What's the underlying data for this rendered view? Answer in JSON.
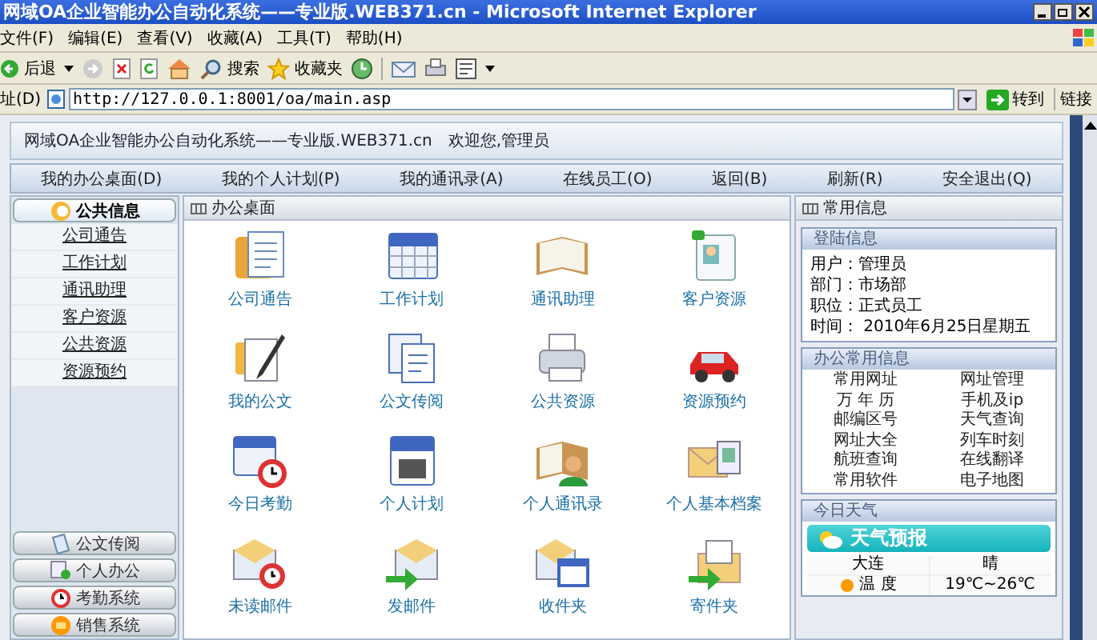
{
  "window": {
    "title": "网域OA企业智能办公自动化系统——专业版.WEB371.cn - Microsoft Internet Explorer"
  },
  "menu_bar": [
    "文件(F)",
    "编辑(E)",
    "查看(V)",
    "收藏(A)",
    "工具(T)",
    "帮助(H)"
  ],
  "toolbar": {
    "back": "后退",
    "search": "搜索",
    "favorites": "收藏夹"
  },
  "address_bar": {
    "label": "址(D)",
    "url": "http://127.0.0.1:8001/oa/main.asp",
    "go": "转到",
    "links": "链接"
  },
  "header": {
    "title": "网域OA企业智能办公自动化系统——专业版.WEB371.cn",
    "welcome": "欢迎您,管理员"
  },
  "nav": [
    "我的办公桌面(D)",
    "我的个人计划(P)",
    "我的通讯录(A)",
    "在线员工(O)",
    "返回(B)",
    "刷新(R)",
    "安全退出(Q)"
  ],
  "sidebar": {
    "groups": [
      {
        "label": "公共信息",
        "expanded": true,
        "items": [
          "公司通告",
          "工作计划",
          "通讯助理",
          "客户资源",
          "公共资源",
          "资源预约"
        ]
      },
      {
        "label": "公文传阅",
        "expanded": false
      },
      {
        "label": "个人办公",
        "expanded": false
      },
      {
        "label": "考勤系统",
        "expanded": false
      },
      {
        "label": "销售系统",
        "expanded": false
      }
    ]
  },
  "desktop": {
    "title": "办公桌面",
    "apps": [
      "公司通告",
      "工作计划",
      "通讯助理",
      "客户资源",
      "我的公文",
      "公文传阅",
      "公共资源",
      "资源预约",
      "今日考勤",
      "个人计划",
      "个人通讯录",
      "个人基本档案",
      "未读邮件",
      "发邮件",
      "收件夹",
      "寄件夹"
    ]
  },
  "info_panel": {
    "title": "常用信息",
    "login": {
      "title": "登陆信息",
      "lines": [
        "用户：管理员",
        "部门：市场部",
        "职位：正式员工",
        "时间： 2010年6月25日星期五"
      ]
    },
    "office": {
      "title": "办公常用信息",
      "links": [
        "常用网址",
        "网址管理",
        "万 年 历",
        "手机及ip",
        "邮编区号",
        "天气查询",
        "网址大全",
        "列车时刻",
        "航班查询",
        "在线翻译",
        "常用软件",
        "电子地图"
      ]
    },
    "weather": {
      "title": "今日天气",
      "banner": "天气预报",
      "city": "大连",
      "condition": "晴",
      "temp_label": "温 度",
      "temp": "19℃~26℃"
    }
  }
}
